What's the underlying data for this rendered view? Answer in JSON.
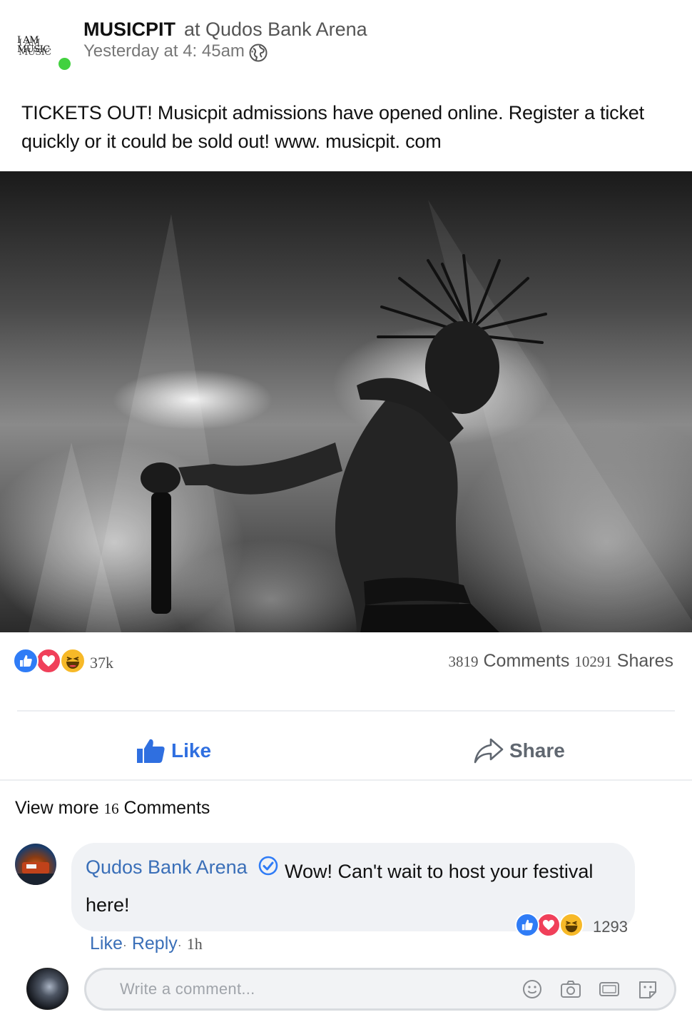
{
  "post": {
    "page_logo_text": "I AM MUSIC",
    "page_name": "MUSICPIT",
    "location_text": "at Qudos Bank Arena",
    "timestamp": "Yesterday at 4: 45am",
    "timestamp_sep": "·",
    "body": "TICKETS OUT! Musicpit admissions have opened online.  Register a ticket quickly or it could be sold out! www. musicpit. com",
    "image_icon": "concert-photo"
  },
  "stats": {
    "reaction_count": "37k",
    "comments_count": "3819",
    "comments_label": "Comments",
    "shares_count": "10291",
    "shares_label": "Shares"
  },
  "actions": {
    "like_label": "Like",
    "share_label": "Share"
  },
  "comments": {
    "view_more_prefix": "View more",
    "view_more_count": "16",
    "view_more_suffix": "Comments",
    "items": [
      {
        "author": "Qudos Bank Arena",
        "text_line1": "Wow! Can't wait to host your festival",
        "text_line2": "here!",
        "reaction_count": "1293",
        "like_label": "Like",
        "reply_label": "Reply",
        "time": "1h"
      }
    ],
    "input_placeholder": "Write a comment..."
  },
  "colors": {
    "like_blue": "#2f7cf6",
    "love_red": "#f0405a",
    "haha_yellow": "#f7b928",
    "online_green": "#42d13f",
    "link_blue": "#3a6fb8"
  }
}
